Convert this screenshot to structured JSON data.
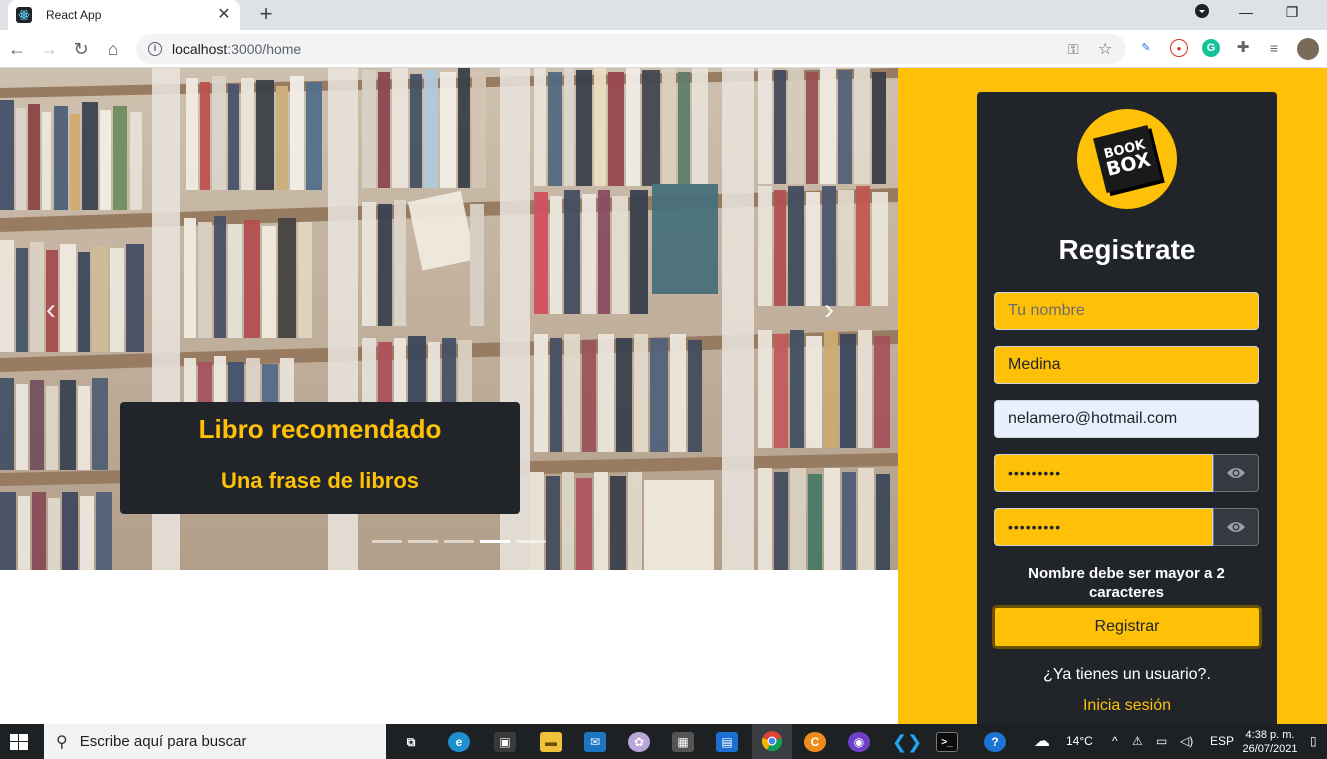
{
  "browser": {
    "tab_title": "React App",
    "url_host": "localhost",
    "url_path": ":3000/home"
  },
  "carousel": {
    "caption_title": "Libro recomendado",
    "caption_subtitle": "Una frase de libros",
    "slide_count": 5,
    "active_slide": 3
  },
  "register": {
    "logo_line1": "BOOK",
    "logo_line2": "BOX",
    "title": "Registrate",
    "name_placeholder": "Tu nombre",
    "lastname_value": "Medina",
    "email_value": "nelamero@hotmail.com",
    "password_mask": "•••••••••",
    "confirm_mask": "•••••••••",
    "error_message": "Nombre debe ser mayor a 2 caracteres",
    "submit_label": "Registrar",
    "already_text": "¿Ya tienes un usuario?.",
    "login_link": "Inicia sesión"
  },
  "taskbar": {
    "search_placeholder": "Escribe aquí para buscar",
    "weather": "14°C",
    "language": "ESP",
    "time": "4:38 p. m.",
    "date": "26/07/2021"
  },
  "colors": {
    "accent": "#ffc107",
    "card_bg": "#212529"
  }
}
